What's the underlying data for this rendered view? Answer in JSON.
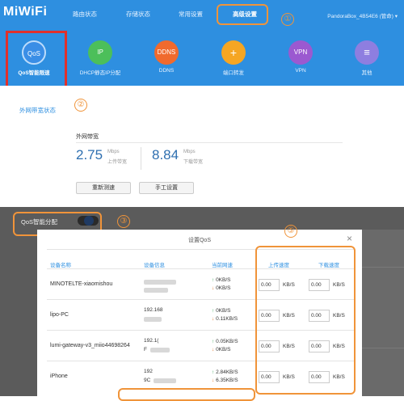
{
  "app": {
    "logo": "MiWiFi"
  },
  "nav": {
    "tabs": [
      "路由状态",
      "存储状态",
      "常用设置",
      "高级设置"
    ],
    "device": "PandoraBox_4B54E6 (管命) ▾"
  },
  "icons": [
    {
      "text": "QoS",
      "label": "QoS智能限速",
      "color": "#2e7fd8"
    },
    {
      "text": "IP",
      "label": "DHCP静态IP分配",
      "color": "#4cbf5a"
    },
    {
      "text": "DDNS",
      "label": "DDNS",
      "color": "#f06a2e"
    },
    {
      "text": "+",
      "label": "端口转发",
      "color": "#f5a623"
    },
    {
      "text": "VPN",
      "label": "VPN",
      "color": "#9b59d0"
    },
    {
      "text": "≡",
      "label": "其他",
      "color": "#8e7ee0"
    }
  ],
  "annotations": {
    "n1": "①",
    "n2": "②",
    "n3": "③",
    "n5": "⑤"
  },
  "wan": {
    "sublink": "外网带宽状态",
    "title": "外网带宽",
    "upload_value": "2.75",
    "upload_unit": "Mbps",
    "upload_label": "上传带宽",
    "download_value": "8.84",
    "download_unit": "Mbps",
    "download_label": "下载带宽",
    "btn_retest": "重新测速",
    "btn_manual": "手工设置"
  },
  "qos_toggle": {
    "label": "QoS智能分配"
  },
  "modal": {
    "title": "设置QoS",
    "close": "×",
    "headers": [
      "设备名称",
      "设备信息",
      "当前网速",
      "上传速度",
      "下载速度"
    ],
    "rows": [
      {
        "name": "MINOTELTE-xiaomishou",
        "info1": "",
        "info2": "",
        "up": "0KB/S",
        "down": "0KB/S",
        "up_limit": "0.00",
        "down_limit": "0.00"
      },
      {
        "name": "lipo-PC",
        "info1": "192.168",
        "info2": "",
        "up": "0KB/S",
        "down": "0.11KB/S",
        "up_limit": "0.00",
        "down_limit": "0.00"
      },
      {
        "name": "lumi-gateway-v3_miio44698264",
        "info1": "192.1(",
        "info2": "F",
        "up": "0.05KB/S",
        "down": "0KB/S",
        "up_limit": "0.00",
        "down_limit": "0.00"
      },
      {
        "name": "iPhone",
        "info1": "192",
        "info2": "9C",
        "up": "2.84KB/S",
        "down": "6.35KB/S",
        "up_limit": "0.00",
        "down_limit": "0.00"
      }
    ],
    "unit": "KB/S"
  },
  "colors": {
    "accent": "#2e8fe0",
    "annotation": "#f0943a",
    "highlight": "#e0302b"
  }
}
